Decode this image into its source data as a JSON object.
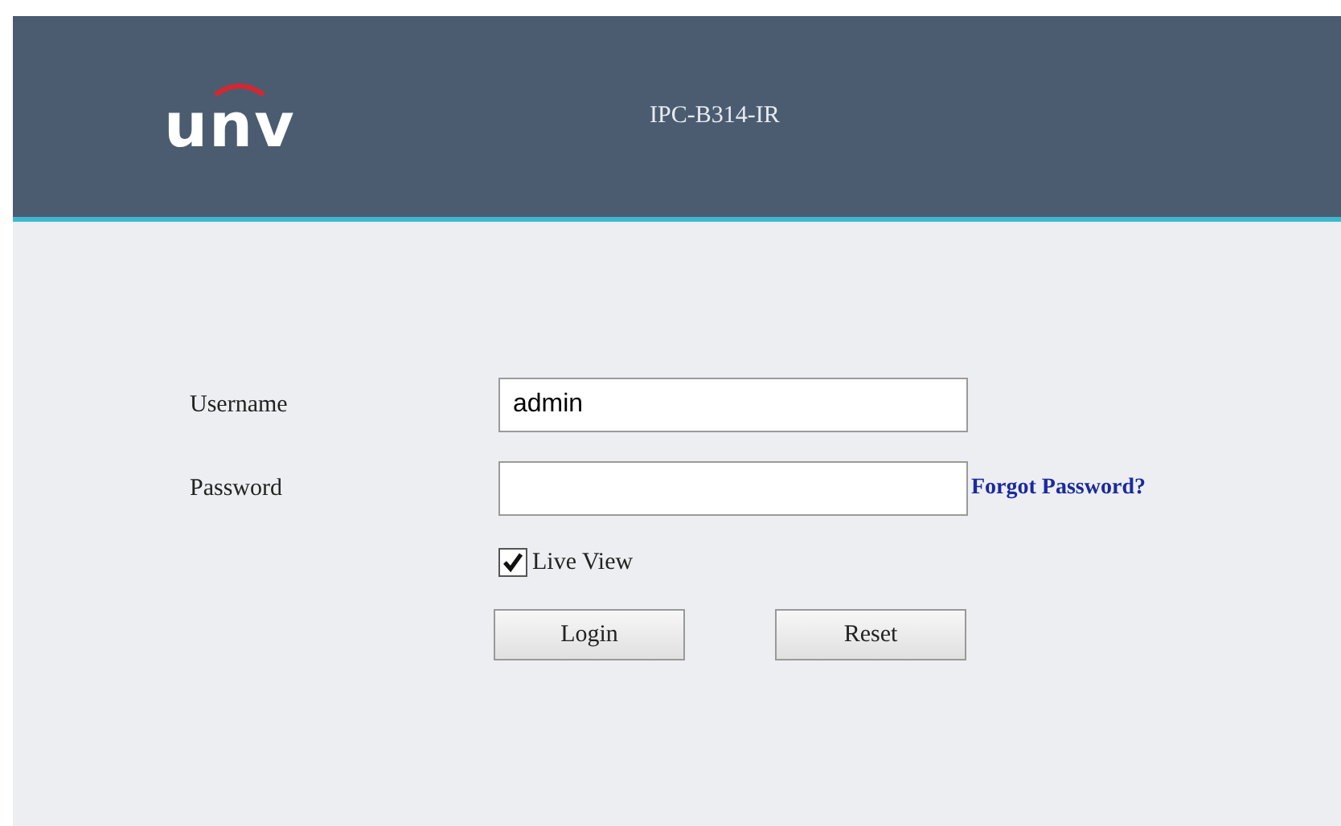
{
  "header": {
    "logo": "unv",
    "title": "IPC-B314-IR"
  },
  "form": {
    "username": {
      "label": "Username",
      "value": "admin"
    },
    "password": {
      "label": "Password",
      "link": "Forgot Password?"
    },
    "live_view": {
      "label": "Live View",
      "checked": true
    },
    "buttons": [
      "Login",
      "Reset"
    ]
  }
}
